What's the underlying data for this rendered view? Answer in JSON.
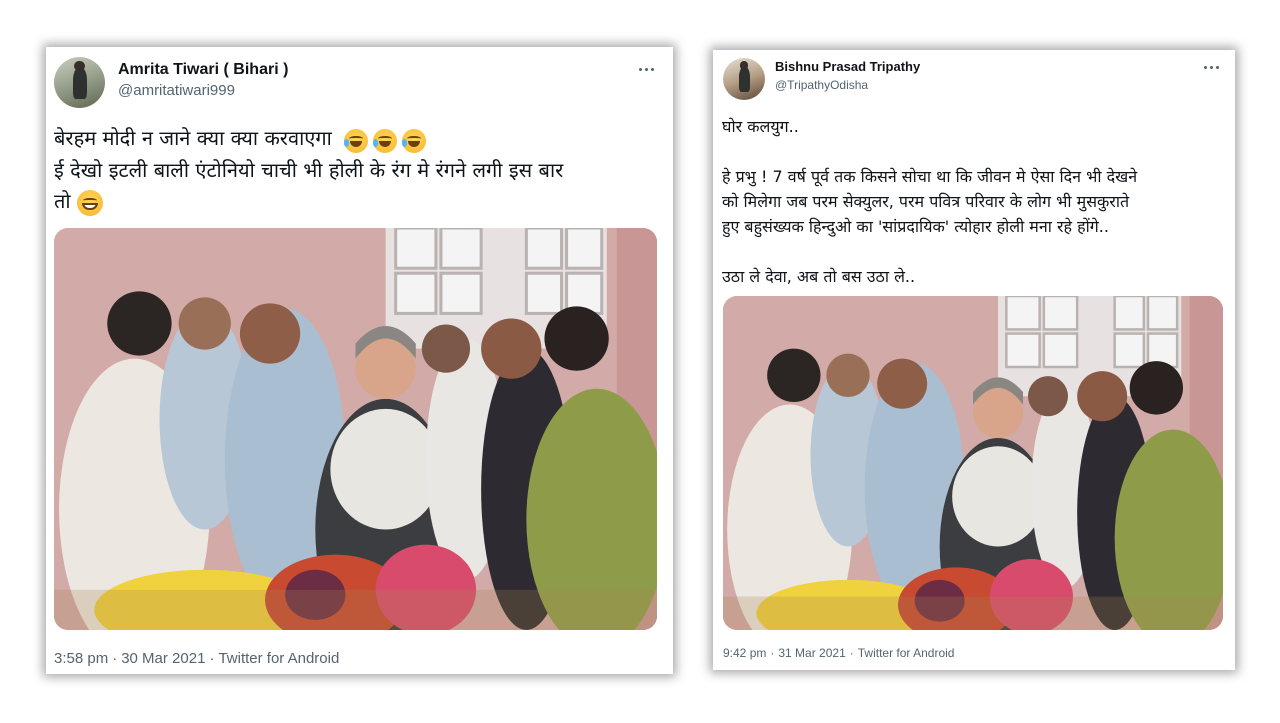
{
  "tweets": [
    {
      "author_name": "Amrita Tiwari ( Bihari )",
      "handle": "@amritatiwari999",
      "text_lines": [
        "बेरहम मोदी न जाने क्या क्या करवाएगा",
        "ई देखो  इटली बाली एंटोनियो चाची भी होली के रंग मे रंगने लगी इस बार",
        "तो"
      ],
      "emojis": [
        "face-with-tears-of-joy",
        "face-with-tears-of-joy",
        "face-with-tears-of-joy",
        "grinning-face-with-smiling-eyes"
      ],
      "time": "3:58 pm",
      "date": "30 Mar 2021",
      "source": "Twitter for Android",
      "separator": "·"
    },
    {
      "author_name": "Bishnu Prasad Tripathy",
      "handle": "@TripathyOdisha",
      "text_lines": [
        "घोर कलयुग..",
        "",
        "हे प्रभु ! 7 वर्ष पूर्व तक किसने सोचा था कि जीवन मे ऐसा दिन भी देखने",
        "को मिलेगा जब परम सेक्युलर, परम पवित्र परिवार के लोग भी मुसकुराते",
        "हुए बहुसंख्यक हिन्दुओ का 'सांप्रदायिक' त्योहार होली मना रहे होंगे..",
        "",
        "उठा ले देवा, अब तो बस उठा ले.."
      ],
      "time": "9:42 pm",
      "date": "31 Mar 2021",
      "source": "Twitter for Android",
      "separator": "·"
    }
  ],
  "icons": {
    "more": "more-options-icon",
    "emoji_laugh": "face-with-tears-of-joy",
    "emoji_grin": "grinning-face-with-smiling-eyes"
  },
  "colors": {
    "text": "#0f1419",
    "secondary": "#536471",
    "card_shadow": "#000000"
  }
}
